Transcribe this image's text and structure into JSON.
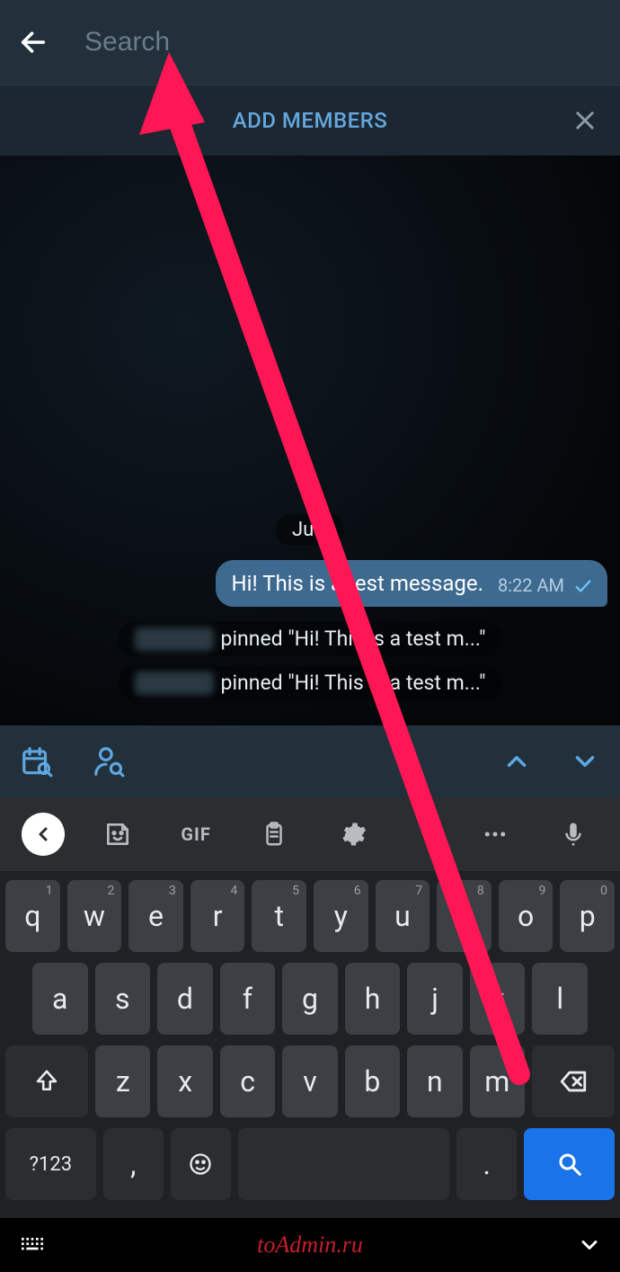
{
  "header": {
    "search_placeholder": "Search",
    "search_value": ""
  },
  "banner": {
    "add_members_label": "ADD MEMBERS"
  },
  "chat": {
    "date_label": "July",
    "message": {
      "text": "Hi! This is a test message.",
      "time": "8:22 AM"
    },
    "service_messages": [
      {
        "text": "pinned \"Hi! This is a test m...\""
      },
      {
        "text": "pinned \"Hi! This is a test m...\""
      }
    ]
  },
  "keyboard_top": {
    "gif_label": "GIF"
  },
  "keyboard": {
    "row1": [
      {
        "k": "q",
        "h": "1"
      },
      {
        "k": "w",
        "h": "2"
      },
      {
        "k": "e",
        "h": "3"
      },
      {
        "k": "r",
        "h": "4"
      },
      {
        "k": "t",
        "h": "5"
      },
      {
        "k": "y",
        "h": "6"
      },
      {
        "k": "u",
        "h": "7"
      },
      {
        "k": "i",
        "h": "8"
      },
      {
        "k": "o",
        "h": "9"
      },
      {
        "k": "p",
        "h": "0"
      }
    ],
    "row2": [
      "a",
      "s",
      "d",
      "f",
      "g",
      "h",
      "j",
      "k",
      "l"
    ],
    "row3": [
      "z",
      "x",
      "c",
      "v",
      "b",
      "n",
      "m"
    ],
    "symbols_label": "?123",
    "comma": ",",
    "period": "."
  },
  "watermark": "toAdmin.ru"
}
